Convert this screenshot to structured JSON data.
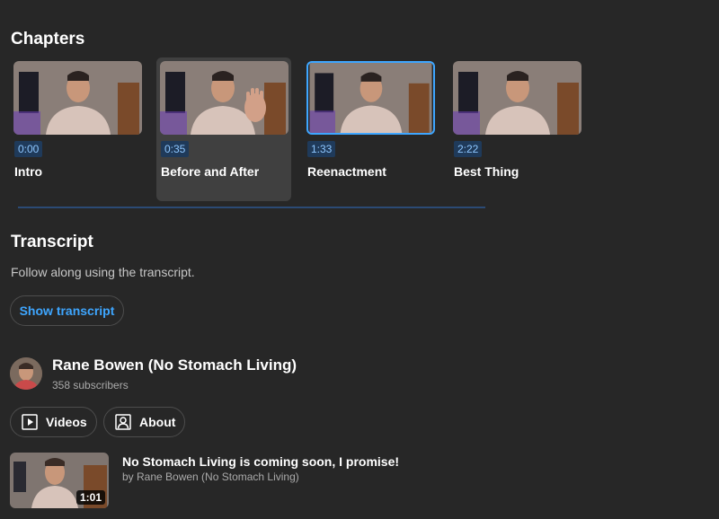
{
  "chapters_section": {
    "title": "Chapters",
    "items": [
      {
        "time": "0:00",
        "label": "Intro"
      },
      {
        "time": "0:35",
        "label": "Before and After"
      },
      {
        "time": "1:33",
        "label": "Reenactment"
      },
      {
        "time": "2:22",
        "label": "Best Thing"
      }
    ]
  },
  "transcript_section": {
    "title": "Transcript",
    "description": "Follow along using the transcript.",
    "button_label": "Show transcript"
  },
  "channel": {
    "name": "Rane Bowen (No Stomach Living)",
    "subscribers": "358 subscribers",
    "videos_label": "Videos",
    "about_label": "About",
    "videos_icon": "play-square-icon",
    "about_icon": "person-frame-icon"
  },
  "featured_video": {
    "title": "No Stomach Living is coming soon, I promise!",
    "byline": "by Rane Bowen (No Stomach Living)",
    "duration": "1:01"
  },
  "colors": {
    "background": "#272727",
    "accent": "#3ea6ff",
    "timeline": "#2b4a75"
  }
}
